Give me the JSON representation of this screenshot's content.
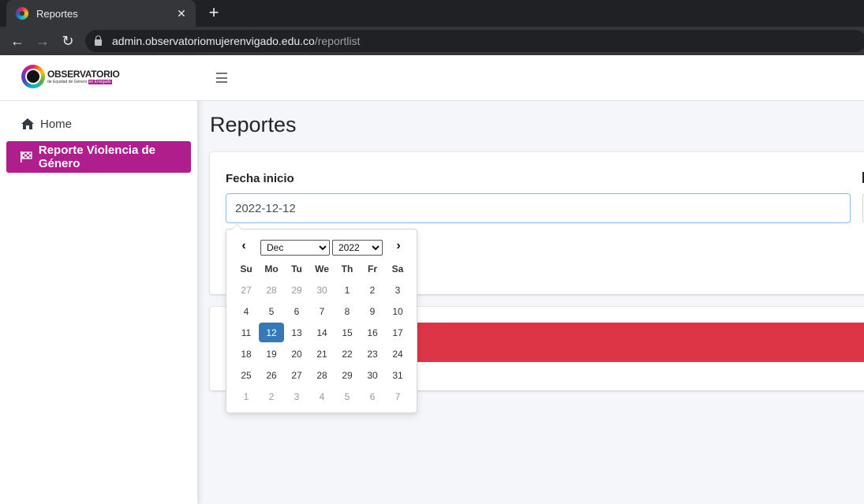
{
  "browser": {
    "tab_title": "Reportes",
    "tab_close_icon": "close-icon",
    "new_tab_label": "+",
    "url_domain": "admin.observatoriomujerenvigado.edu.co",
    "url_path": "/reportlist"
  },
  "sidebar": {
    "brand_title": "OBSERVATORIO",
    "brand_sub_prefix": "de Equidad de Género",
    "brand_sub_highlight": "en Envigado",
    "items": [
      {
        "label": "Home",
        "icon": "home-icon"
      },
      {
        "label": "Reporte Violencia de Género",
        "icon": "flag-checkered-icon"
      }
    ]
  },
  "main": {
    "page_title": "Reportes",
    "filter": {
      "fecha_inicio_label": "Fecha inicio",
      "fecha_inicio_value": "2022-12-12"
    }
  },
  "datepicker": {
    "month_selected": "Dec",
    "year_selected": "2022",
    "weekdays": [
      "Su",
      "Mo",
      "Tu",
      "We",
      "Th",
      "Fr",
      "Sa"
    ],
    "weeks": [
      [
        "27",
        "28",
        "29",
        "30",
        "1",
        "2",
        "3"
      ],
      [
        "4",
        "5",
        "6",
        "7",
        "8",
        "9",
        "10"
      ],
      [
        "11",
        "12",
        "13",
        "14",
        "15",
        "16",
        "17"
      ],
      [
        "18",
        "19",
        "20",
        "21",
        "22",
        "23",
        "24"
      ],
      [
        "25",
        "26",
        "27",
        "28",
        "29",
        "30",
        "31"
      ],
      [
        "1",
        "2",
        "3",
        "4",
        "5",
        "6",
        "7"
      ]
    ],
    "selected_day": "12"
  },
  "colors": {
    "brand_magenta": "#b01e8e",
    "danger_red": "#dc3545",
    "datepicker_active": "#337ab7"
  }
}
